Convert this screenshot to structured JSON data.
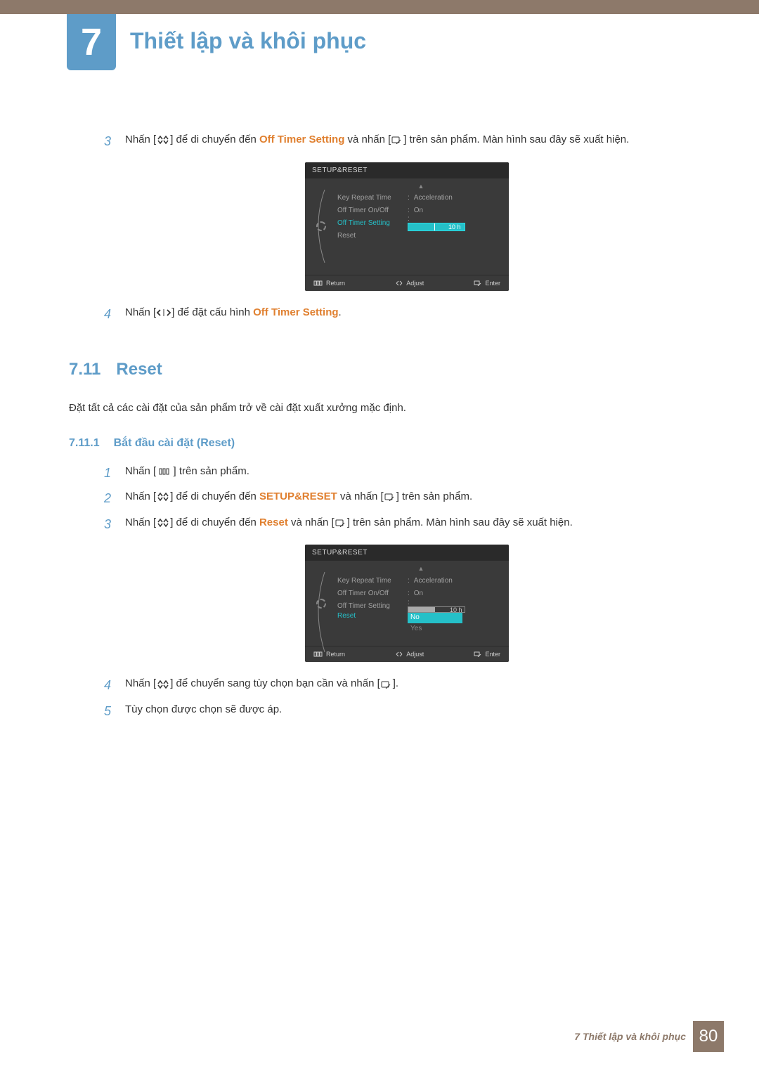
{
  "chapter": {
    "number": "7",
    "title": "Thiết lập và khôi phục"
  },
  "stepsA": {
    "s3": {
      "num": "3",
      "p1": "Nhấn [",
      "p2": "] để di chuyển đến ",
      "hl": "Off Timer Setting",
      "p3": " và nhấn [",
      "p4": "] trên sản phẩm. Màn hình sau đây sẽ xuất hiện."
    },
    "s4": {
      "num": "4",
      "p1": "Nhấn [",
      "p2": "] để đặt cấu hình ",
      "hl": "Off Timer Setting",
      "p3": "."
    }
  },
  "osd1": {
    "title": "SETUP&RESET",
    "items": {
      "keyRepeat": {
        "label": "Key Repeat Time",
        "value": "Acceleration"
      },
      "offTimerOnOff": {
        "label": "Off Timer On/Off",
        "value": "On"
      },
      "offTimerSetting": {
        "label": "Off Timer Setting",
        "value": "10 h"
      },
      "reset": {
        "label": "Reset"
      }
    },
    "footer": {
      "return": "Return",
      "adjust": "Adjust",
      "enter": "Enter"
    }
  },
  "section": {
    "num": "7.11",
    "title": "Reset",
    "desc": "Đặt tất cả các cài đặt của sản phẩm trở về cài đặt xuất xưởng mặc định."
  },
  "subsection": {
    "num": "7.11.1",
    "title": "Bắt đầu cài đặt (Reset)"
  },
  "stepsB": {
    "s1": {
      "num": "1",
      "p1": "Nhấn [ ",
      "p2": " ] trên sản phẩm."
    },
    "s2": {
      "num": "2",
      "p1": "Nhấn [",
      "p2": "] để di chuyển đến ",
      "hl": "SETUP&RESET",
      "p3": " và nhấn [",
      "p4": "] trên sản phẩm."
    },
    "s3": {
      "num": "3",
      "p1": "Nhấn [",
      "p2": "] để di chuyển đến ",
      "hl": "Reset",
      "p3": " và nhấn [",
      "p4": "] trên sản phẩm. Màn hình sau đây sẽ xuất hiện."
    },
    "s4": {
      "num": "4",
      "p1": "Nhấn [",
      "p2": "] để chuyển sang tùy chọn bạn cần và nhấn [",
      "p3": "]."
    },
    "s5": {
      "num": "5",
      "text": "Tùy chọn được chọn sẽ được áp."
    }
  },
  "osd2": {
    "title": "SETUP&RESET",
    "items": {
      "keyRepeat": {
        "label": "Key Repeat Time",
        "value": "Acceleration"
      },
      "offTimerOnOff": {
        "label": "Off Timer On/Off",
        "value": "On"
      },
      "offTimerSetting": {
        "label": "Off Timer Setting",
        "value": "10 h"
      },
      "reset": {
        "label": "Reset",
        "no": "No",
        "yes": "Yes"
      }
    },
    "footer": {
      "return": "Return",
      "adjust": "Adjust",
      "enter": "Enter"
    }
  },
  "footer": {
    "text": "7 Thiết lập và khôi phục",
    "page": "80"
  }
}
